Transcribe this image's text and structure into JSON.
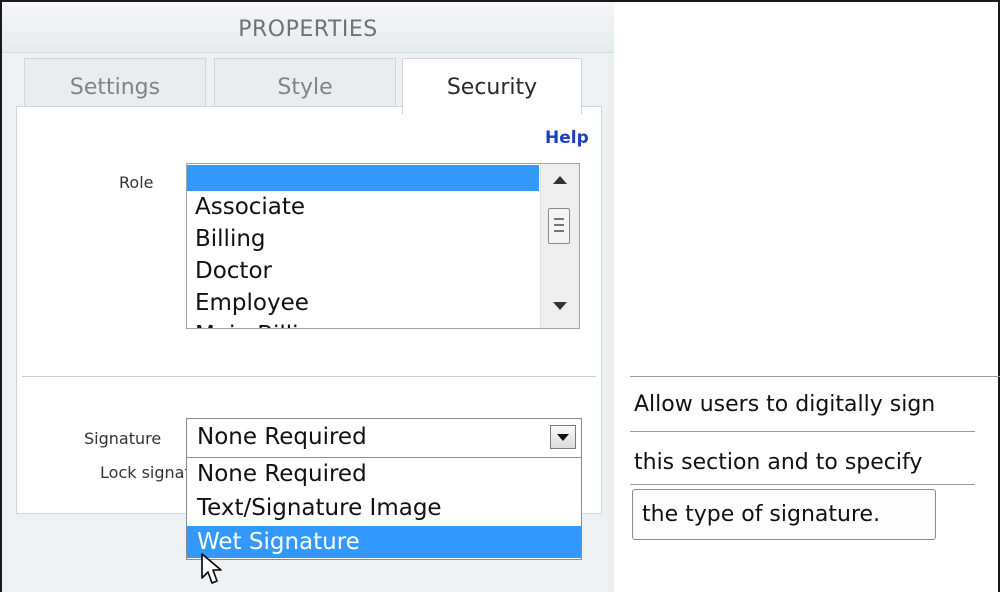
{
  "panel": {
    "title": "PROPERTIES",
    "tabs": [
      "Settings",
      "Style",
      "Security"
    ],
    "active_tab": "Security",
    "help_link": "Help"
  },
  "role": {
    "label": "Role",
    "items": [
      "",
      "Associate",
      "Billing",
      "Doctor",
      "Employee",
      "Main Billing"
    ],
    "selected_index": 0
  },
  "signature": {
    "label": "Signature",
    "value": "None Required",
    "lock_label": "Lock signature",
    "options": [
      "None Required",
      "Text/Signature Image",
      "Wet Signature"
    ],
    "highlighted": "Wet Signature"
  },
  "callout": {
    "lines": [
      "Allow users to digitally sign",
      "this section and to specify",
      "the type of signature."
    ]
  },
  "colors": {
    "selection": "#3399ff",
    "link": "#1f3fbf",
    "panel_bg": "#edf1f3"
  }
}
